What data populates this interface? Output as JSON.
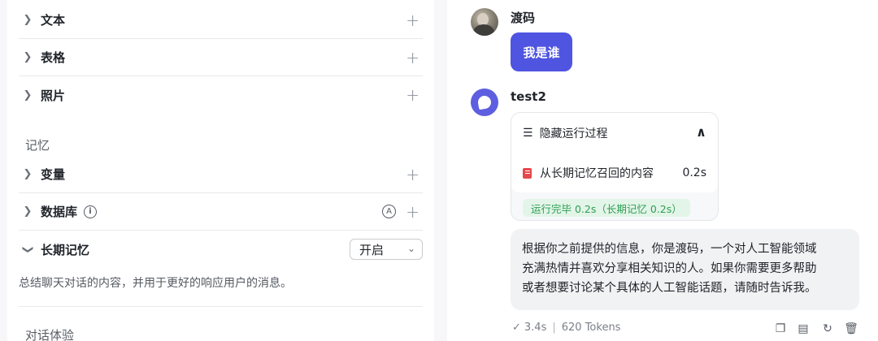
{
  "left": {
    "items": [
      {
        "label": "文本"
      },
      {
        "label": "表格"
      },
      {
        "label": "照片"
      }
    ],
    "memory_section": "记忆",
    "variables_label": "变量",
    "database_label": "数据库",
    "long_memory_label": "长期记忆",
    "long_memory_select": "开启",
    "long_memory_desc": "总结聊天对话的内容，并用于更好的响应用户的消息。",
    "experience_section": "对话体验"
  },
  "chat": {
    "user_name": "渡码",
    "user_message": "我是谁",
    "bot_name": "test2",
    "process_title": "隐藏运行过程",
    "memory_step_label": "从长期记忆召回的内容",
    "memory_step_time": "0.2s",
    "done_badge": "运行完毕 0.2s（长期记忆 0.2s）",
    "answer_lines": [
      "根据你之前提供的信息，你是渡码，一个对人工智能领域",
      "充满热情并喜欢分享相关知识的人。如果你需要更多帮助",
      "或者想要讨论某个具体的人工智能话题，请随时告诉我。"
    ],
    "latency": "3.4s",
    "tokens": "620 Tokens"
  },
  "icons": {
    "chevron_right": "chevron-right-icon",
    "chevron_down": "chevron-down-icon",
    "plus": "plus-icon",
    "info": "info-icon",
    "auto": "auto-a-icon",
    "list": "list-icon",
    "collapse": "chevron-up-icon",
    "memory": "memory-icon",
    "copy": "copy-icon",
    "note": "note-icon",
    "refresh": "refresh-icon",
    "delete": "trash-icon"
  },
  "colors": {
    "accent": "#4f55e0",
    "success_bg": "#e3f5e8",
    "success_text": "#2f9e55",
    "memory_icon": "#e5484d"
  }
}
